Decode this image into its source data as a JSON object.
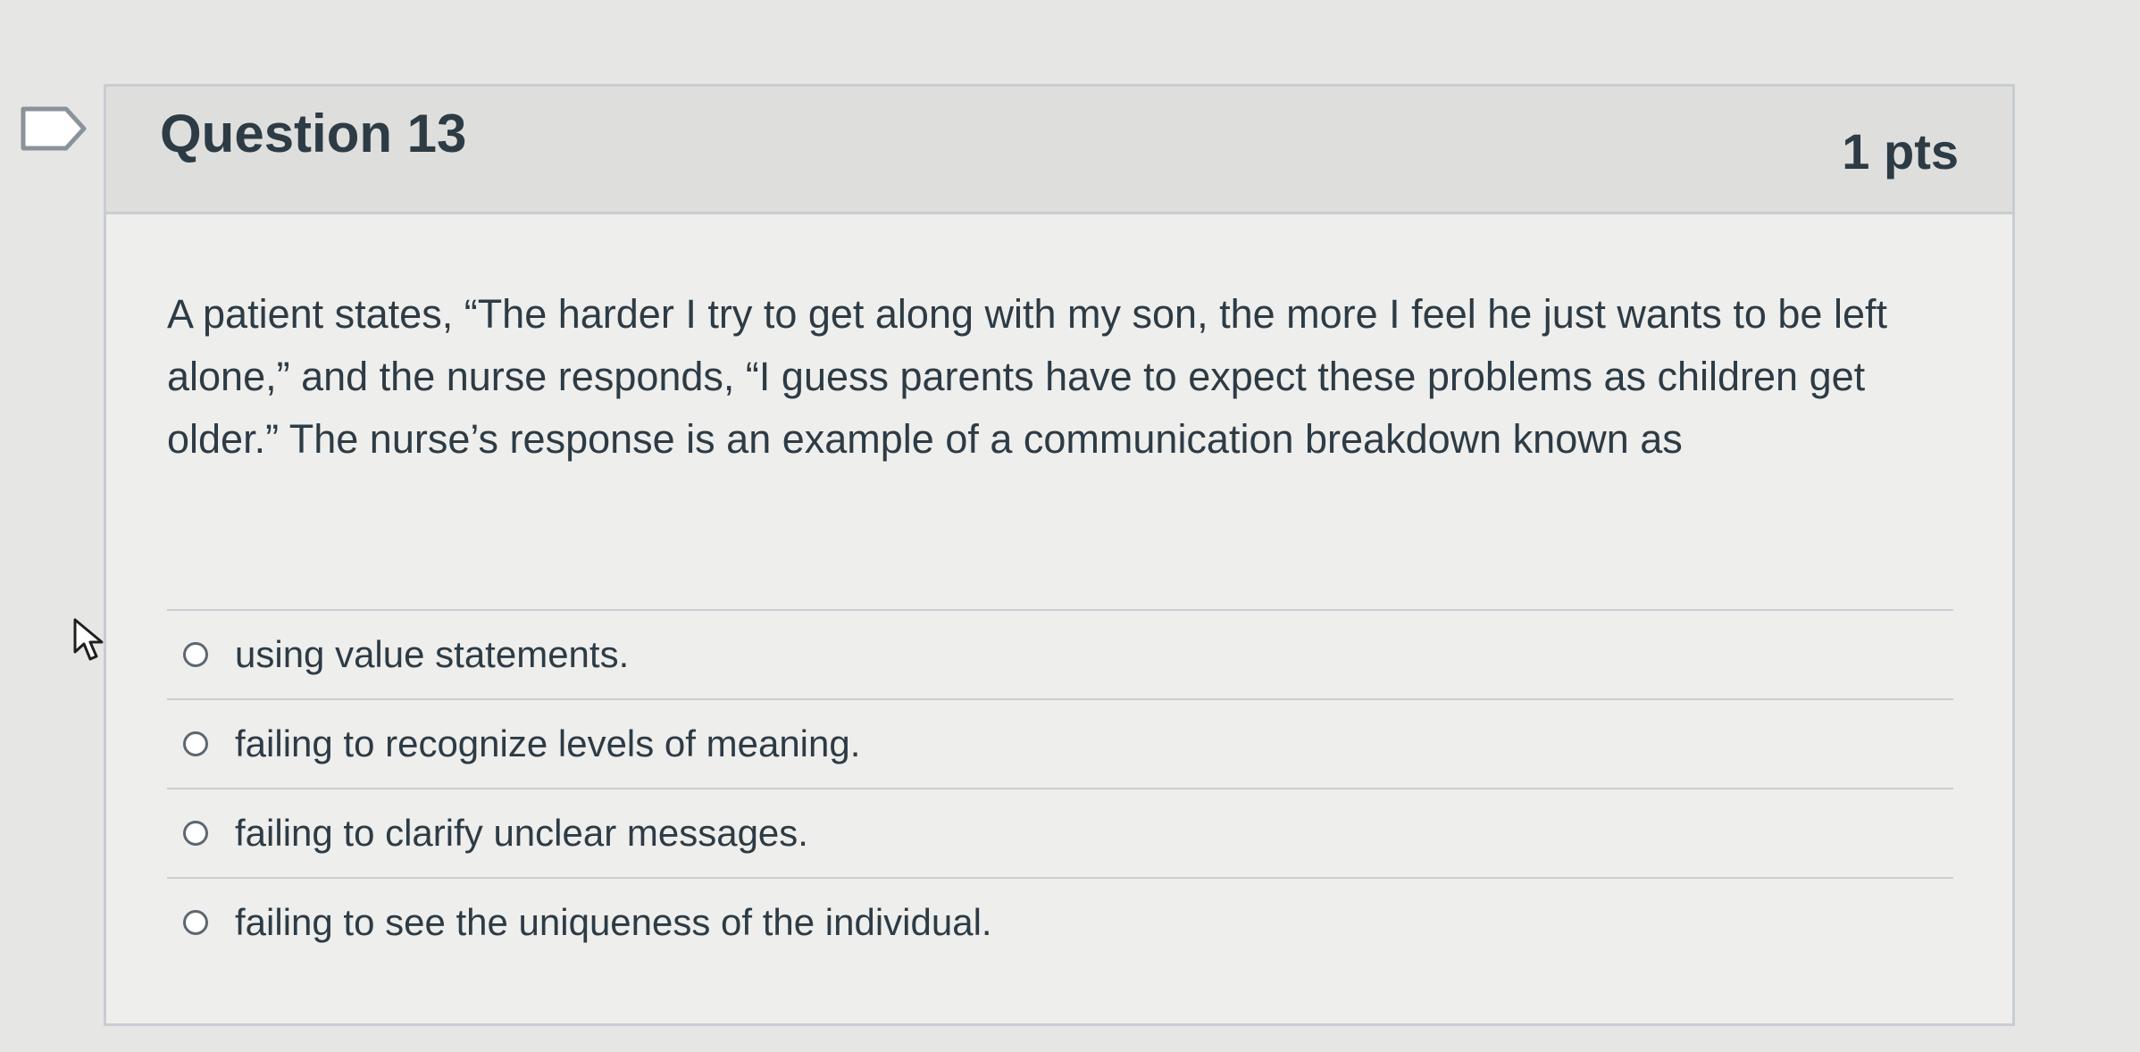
{
  "question": {
    "title": "Question 13",
    "points": "1 pts",
    "text": "A patient states, “The harder I try to get along with my son, the more I feel he just wants to be left alone,” and the nurse responds, “I guess parents have to expect these problems as children get older.” The nurse’s response is an example of a communication breakdown known as",
    "answers": [
      {
        "label": "using value statements."
      },
      {
        "label": "failing to recognize levels of meaning."
      },
      {
        "label": "failing to clarify unclear messages."
      },
      {
        "label": "failing to see the uniqueness of the individual."
      }
    ]
  },
  "icons": {
    "flag": "flag-icon",
    "cursor": "mouse-pointer-icon",
    "radio": "radio-unchecked-icon"
  },
  "colors": {
    "text": "#2d3b45",
    "header_background": "#dedfdd",
    "card_background": "#eeeeec",
    "border": "#c7cdd1"
  }
}
